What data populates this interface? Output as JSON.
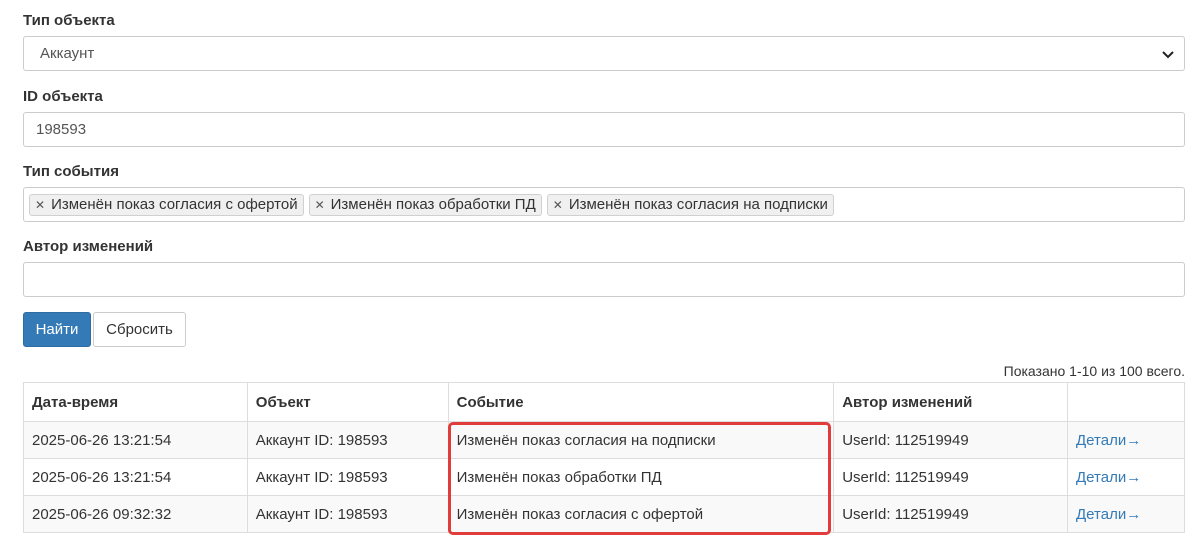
{
  "filters": {
    "object_type": {
      "label": "Тип объекта",
      "value": "Аккаунт"
    },
    "object_id": {
      "label": "ID объекта",
      "value": "198593"
    },
    "event_type": {
      "label": "Тип события",
      "tags": [
        "Изменён показ согласия с офертой",
        "Изменён показ обработки ПД",
        "Изменён показ согласия на подписки"
      ]
    },
    "author": {
      "label": "Автор изменений",
      "value": ""
    }
  },
  "buttons": {
    "search_label": "Найти",
    "reset_label": "Сбросить"
  },
  "summary": "Показано 1-10 из 100 всего.",
  "table": {
    "headers": [
      "Дата-время",
      "Объект",
      "Событие",
      "Автор изменений",
      ""
    ],
    "rows": [
      {
        "datetime": "2025-06-26 13:21:54",
        "object": "Аккаунт ID: 198593",
        "event": "Изменён показ согласия на подписки",
        "author": "UserId: 112519949",
        "details": "Детали→"
      },
      {
        "datetime": "2025-06-26 13:21:54",
        "object": "Аккаунт ID: 198593",
        "event": "Изменён показ обработки ПД",
        "author": "UserId: 112519949",
        "details": "Детали→"
      },
      {
        "datetime": "2025-06-26 09:32:32",
        "object": "Аккаунт ID: 198593",
        "event": "Изменён показ согласия с офертой",
        "author": "UserId: 112519949",
        "details": "Детали→"
      }
    ]
  },
  "colors": {
    "primary": "#337ab7",
    "highlight": "#e03c3c",
    "link": "#337ab7"
  },
  "icons": {
    "select_chevron": "chevron-down-icon",
    "tag_remove": "close-icon"
  }
}
